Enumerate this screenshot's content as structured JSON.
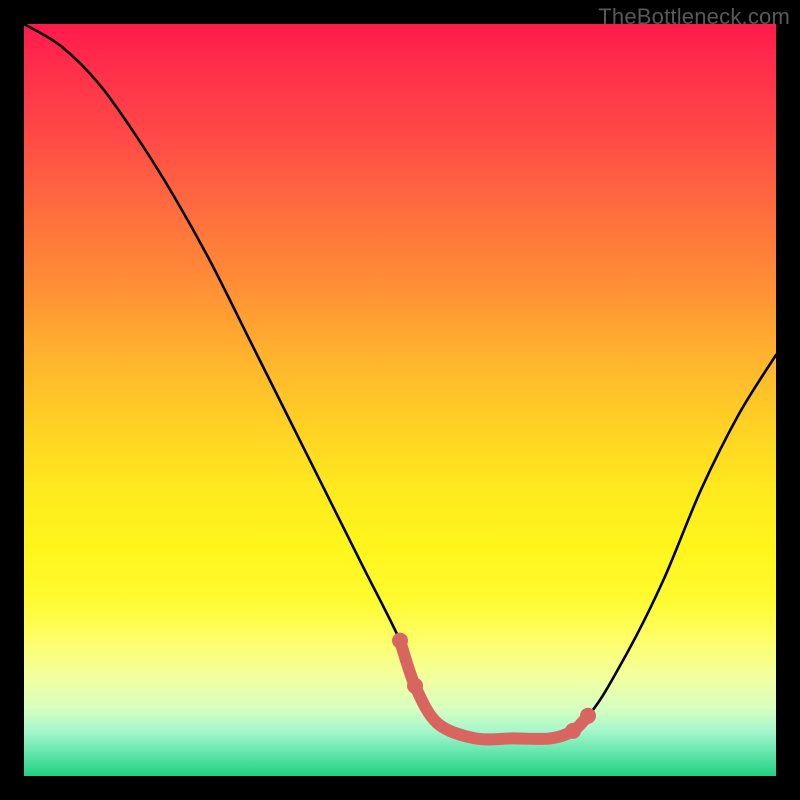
{
  "watermark": "TheBottleneck.com",
  "chart_data": {
    "type": "line",
    "title": "",
    "xlabel": "",
    "ylabel": "",
    "xlim": [
      0,
      100
    ],
    "ylim": [
      0,
      100
    ],
    "grid": false,
    "series": [
      {
        "name": "curve",
        "color": "#000000",
        "x": [
          0,
          5,
          10,
          15,
          20,
          25,
          30,
          35,
          40,
          45,
          50,
          52,
          55,
          60,
          65,
          70,
          75,
          80,
          85,
          90,
          95,
          100
        ],
        "y": [
          100,
          97,
          92,
          85,
          77,
          68,
          58,
          48,
          38,
          28,
          18,
          12,
          7,
          5,
          5,
          5,
          8,
          16,
          26,
          38,
          48,
          56
        ]
      },
      {
        "name": "highlight",
        "color": "#d8655f",
        "x": [
          50,
          52,
          55,
          60,
          65,
          70,
          73,
          75
        ],
        "y": [
          18,
          12,
          7,
          5,
          5,
          5,
          6,
          8
        ]
      }
    ],
    "highlight_points": [
      {
        "x": 50,
        "y": 18
      },
      {
        "x": 52,
        "y": 12
      },
      {
        "x": 73,
        "y": 6
      },
      {
        "x": 75,
        "y": 8
      }
    ]
  }
}
